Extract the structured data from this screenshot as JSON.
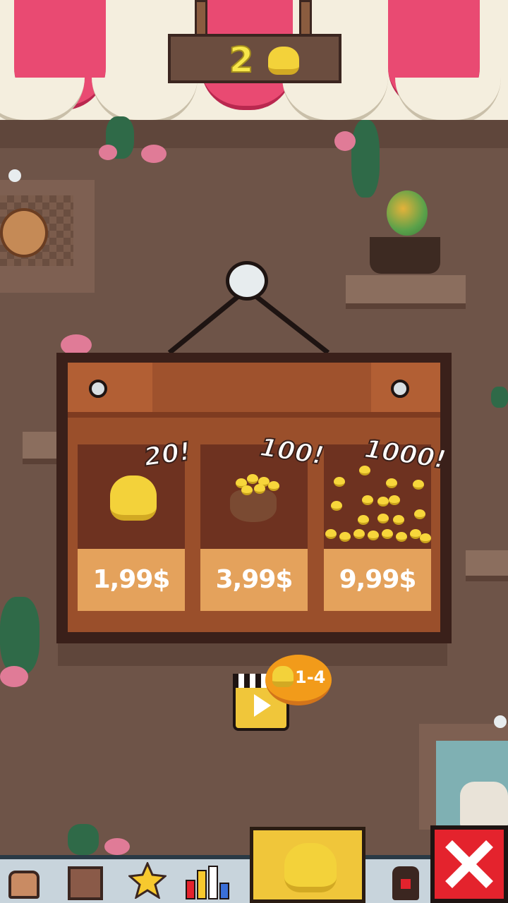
{
  "header": {
    "coin_count": "2",
    "coin_icon": "gold-chick-coin"
  },
  "shop": {
    "offers": [
      {
        "amount": "20!",
        "price": "1,99$",
        "icon": "single-chick-coin"
      },
      {
        "amount": "100!",
        "price": "3,99$",
        "icon": "coin-bag"
      },
      {
        "amount": "1000!",
        "price": "9,99$",
        "icon": "coin-fountain"
      }
    ]
  },
  "ad_reward": {
    "label": "1-4",
    "icon": "video-clapper-play"
  },
  "bottom_nav": {
    "items": [
      {
        "name": "backpack",
        "icon": "backpack-icon"
      },
      {
        "name": "wardrobe",
        "icon": "wardrobe-icon"
      },
      {
        "name": "favorites",
        "icon": "star-icon"
      },
      {
        "name": "stats",
        "icon": "bar-chart-icon"
      },
      {
        "name": "shop",
        "icon": "coin-icon",
        "active": true
      },
      {
        "name": "profile",
        "icon": "character-icon"
      },
      {
        "name": "close",
        "icon": "close-icon"
      }
    ]
  },
  "colors": {
    "accent": "#f0c63a",
    "price_bg": "#e4a25c",
    "close": "#e4232d",
    "awning": "#e94a72"
  }
}
